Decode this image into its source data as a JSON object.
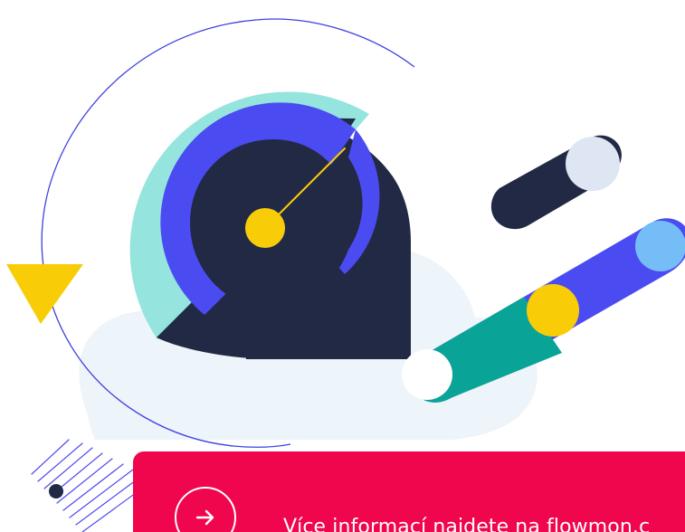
{
  "illustration": {
    "theme_colors": {
      "cyan": "#95e4de",
      "blue": "#4b4bf2",
      "navy": "#222945",
      "yellow": "#f8cd07",
      "green": "#0aa397",
      "light_blue": "#75bdf7",
      "pale_blue": "#dde6f2",
      "cloud": "#edf4fa",
      "red": "#f0064d"
    },
    "icons": [
      "speedometer-gauge-icon",
      "warning-triangle-icon",
      "speed-trail-icons"
    ]
  },
  "cta": {
    "background_color": "#f0064d",
    "arrow_icon": "arrow-right-icon",
    "link_text": "Více informací najdete na flowmon.c"
  }
}
